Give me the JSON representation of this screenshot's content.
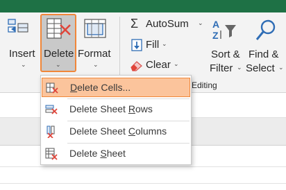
{
  "ribbon": {
    "cells": {
      "insert": {
        "label": "Insert",
        "caret": "⌄"
      },
      "delete": {
        "label": "Delete",
        "caret": "⌄"
      },
      "format": {
        "label": "Format",
        "caret": "⌄"
      }
    },
    "editing": {
      "autosum": {
        "label": "AutoSum",
        "caret": "⌄"
      },
      "fill": {
        "label": "Fill",
        "caret": "⌄"
      },
      "clear": {
        "label": "Clear",
        "caret": "⌄"
      },
      "sort_filter": {
        "line1": "Sort &",
        "line2": "Filter",
        "caret": "⌄"
      },
      "find_select": {
        "line1": "Find &",
        "line2": "Select",
        "caret": "⌄"
      },
      "group_label": "Editing"
    }
  },
  "delete_menu": {
    "items": [
      {
        "label": "Delete Cells...",
        "underline_char": "D",
        "rest": "elete Cells...",
        "icon": "delete-cells-icon",
        "highlighted": true
      },
      {
        "label": "Delete Sheet Rows",
        "prefix": "Delete Sheet ",
        "underline_char": "R",
        "rest": "ows",
        "icon": "delete-sheet-rows-icon",
        "highlighted": false
      },
      {
        "label": "Delete Sheet Columns",
        "prefix": "Delete Sheet ",
        "underline_char": "C",
        "rest": "olumns",
        "icon": "delete-sheet-columns-icon",
        "highlighted": false
      },
      {
        "label": "Delete Sheet",
        "prefix": "Delete ",
        "underline_char": "S",
        "rest": "heet",
        "icon": "delete-sheet-icon",
        "highlighted": false
      }
    ]
  },
  "colors": {
    "title_bar": "#1e7145",
    "highlight_fill": "#fbc49c",
    "highlight_border": "#f0873a",
    "delete_red": "#e0453a",
    "icon_blue": "#2f6db5"
  }
}
